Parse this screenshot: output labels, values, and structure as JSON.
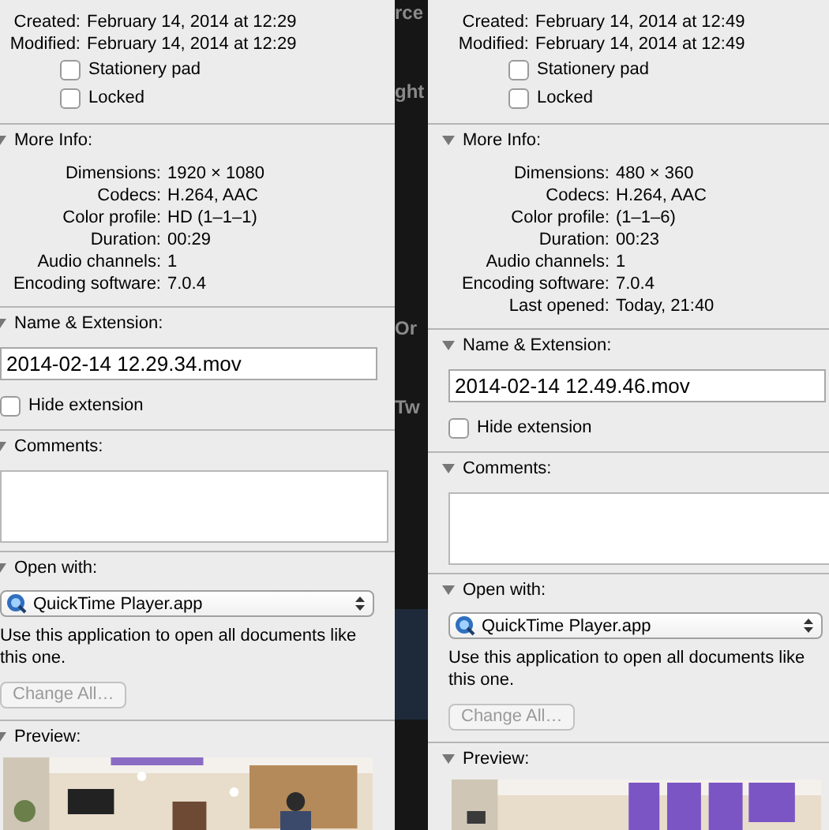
{
  "background_window": {
    "fragments": [
      "rce",
      "ght",
      "Or",
      "Tw"
    ]
  },
  "panels": [
    {
      "dates": [
        {
          "label": "Created:",
          "value": "February 14, 2014 at 12:29"
        },
        {
          "label": "Modified:",
          "value": "February 14, 2014 at 12:29"
        }
      ],
      "checkboxes": [
        {
          "label": "Stationery pad",
          "checked": false
        },
        {
          "label": "Locked",
          "checked": false
        }
      ],
      "more_info": {
        "title": "More Info:",
        "expanded": true,
        "fields": [
          {
            "label": "Dimensions:",
            "value": "1920 × 1080"
          },
          {
            "label": "Codecs:",
            "value": "H.264, AAC"
          },
          {
            "label": "Color profile:",
            "value": "HD (1–1–1)"
          },
          {
            "label": "Duration:",
            "value": "00:29"
          },
          {
            "label": "Audio channels:",
            "value": "1"
          },
          {
            "label": "Encoding software:",
            "value": "7.0.4"
          }
        ]
      },
      "name_extension": {
        "title": "Name & Extension:",
        "expanded": true,
        "value": "2014-02-14 12.29.34.mov",
        "hide_extension": {
          "label": "Hide extension",
          "checked": false
        }
      },
      "comments": {
        "title": "Comments:",
        "expanded": true
      },
      "open_with": {
        "title": "Open with:",
        "expanded": true,
        "app": "QuickTime Player.app",
        "note": "Use this application to open all documents like this one.",
        "button": {
          "label": "Change All…",
          "disabled": true
        }
      },
      "preview": {
        "title": "Preview:",
        "expanded": true,
        "kind": "picture"
      }
    },
    {
      "dates": [
        {
          "label": "Created:",
          "value": "February 14, 2014 at 12:49"
        },
        {
          "label": "Modified:",
          "value": "February 14, 2014 at 12:49"
        }
      ],
      "checkboxes": [
        {
          "label": "Stationery pad",
          "checked": false
        },
        {
          "label": "Locked",
          "checked": false
        }
      ],
      "more_info": {
        "title": "More Info:",
        "expanded": true,
        "fields": [
          {
            "label": "Dimensions:",
            "value": "480 × 360"
          },
          {
            "label": "Codecs:",
            "value": "H.264, AAC"
          },
          {
            "label": "Color profile:",
            "value": "(1–1–6)"
          },
          {
            "label": "Duration:",
            "value": "00:23"
          },
          {
            "label": "Audio channels:",
            "value": "1"
          },
          {
            "label": "Encoding software:",
            "value": "7.0.4"
          },
          {
            "label": "Last opened:",
            "value": "Today, 21:40"
          }
        ]
      },
      "name_extension": {
        "title": "Name & Extension:",
        "expanded": true,
        "value": "2014-02-14 12.49.46.mov",
        "hide_extension": {
          "label": "Hide extension",
          "checked": false
        }
      },
      "comments": {
        "title": "Comments:",
        "expanded": true
      },
      "open_with": {
        "title": "Open with:",
        "expanded": true,
        "app": "QuickTime Player.app",
        "note": "Use this application to open all documents like this one.",
        "button": {
          "label": "Change All…",
          "disabled": true
        }
      },
      "preview": {
        "title": "Preview:",
        "expanded": true,
        "kind": "picture"
      }
    }
  ]
}
